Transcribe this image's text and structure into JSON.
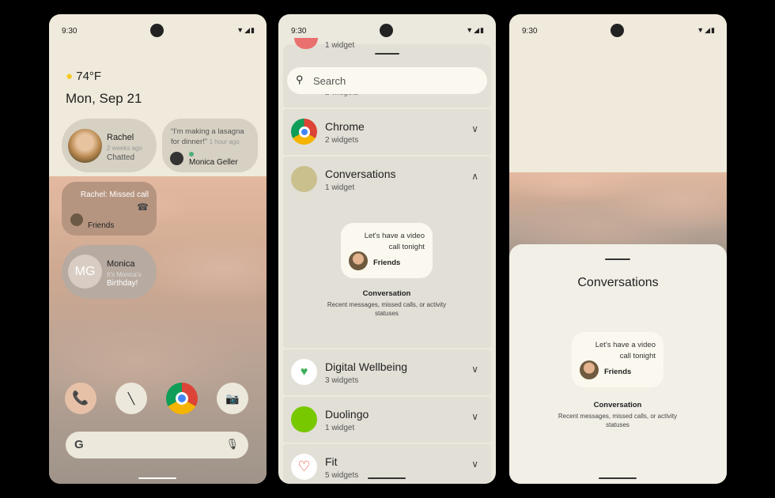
{
  "status": {
    "time": "9:30"
  },
  "home": {
    "weather": "74°F",
    "date": "Mon, Sep 21",
    "rachel": {
      "name": "Rachel",
      "time": "2 weeks ago",
      "status": "Chatted"
    },
    "monica_geller": {
      "quote": "“I'm making a lasagna for dinner!”",
      "time": "1 hour ago",
      "name": "Monica Geller"
    },
    "missed": {
      "text": "Rachel: Missed call",
      "group": "Friends"
    },
    "monica": {
      "initials": "MG",
      "name": "Monica",
      "line1": "It's Monica's",
      "line2": "Birthday!"
    },
    "search_logo": "G"
  },
  "picker": {
    "search_placeholder": "Search",
    "partial_top": "1 widget",
    "partial_under": "2 widgets",
    "apps": [
      {
        "name": "Chrome",
        "count": "2 widgets"
      },
      {
        "name": "Conversations",
        "count": "1 widget"
      },
      {
        "name": "Digital Wellbeing",
        "count": "3 widgets"
      },
      {
        "name": "Duolingo",
        "count": "1 widget"
      },
      {
        "name": "Fit",
        "count": "5 widgets"
      }
    ]
  },
  "conversation_widget": {
    "message": "Let's have a video call tonight",
    "contact": "Friends",
    "title": "Conversation",
    "description": "Recent messages, missed calls, or activity statuses"
  },
  "sheet": {
    "title": "Conversations"
  }
}
